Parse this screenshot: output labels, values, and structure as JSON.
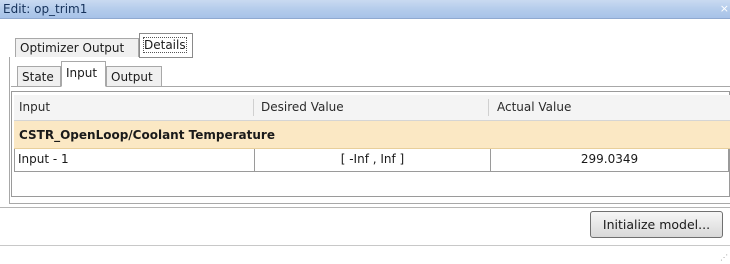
{
  "window": {
    "title": "Edit: op_trim1",
    "close_glyph": "×"
  },
  "outer_tabs": [
    {
      "label": "Optimizer Output",
      "active": false
    },
    {
      "label": "Details",
      "active": true
    }
  ],
  "inner_tabs": [
    {
      "label": "State",
      "active": false
    },
    {
      "label": "Input",
      "active": true
    },
    {
      "label": "Output",
      "active": false
    }
  ],
  "table": {
    "columns": [
      "Input",
      "Desired Value",
      "Actual Value"
    ],
    "group_label": "CSTR_OpenLoop/Coolant Temperature",
    "rows": [
      {
        "input": "Input - 1",
        "desired": "[ -Inf , Inf ]",
        "actual": "299.0349"
      }
    ]
  },
  "buttons": {
    "initialize_model": "Initialize model..."
  },
  "colors": {
    "title_bar": "#b3cbeb",
    "group_row": "#fbe8c4",
    "header_row": "#f4f4f4"
  },
  "icons": {
    "close": "close-icon",
    "resize_grip": "resize-grip-icon"
  }
}
